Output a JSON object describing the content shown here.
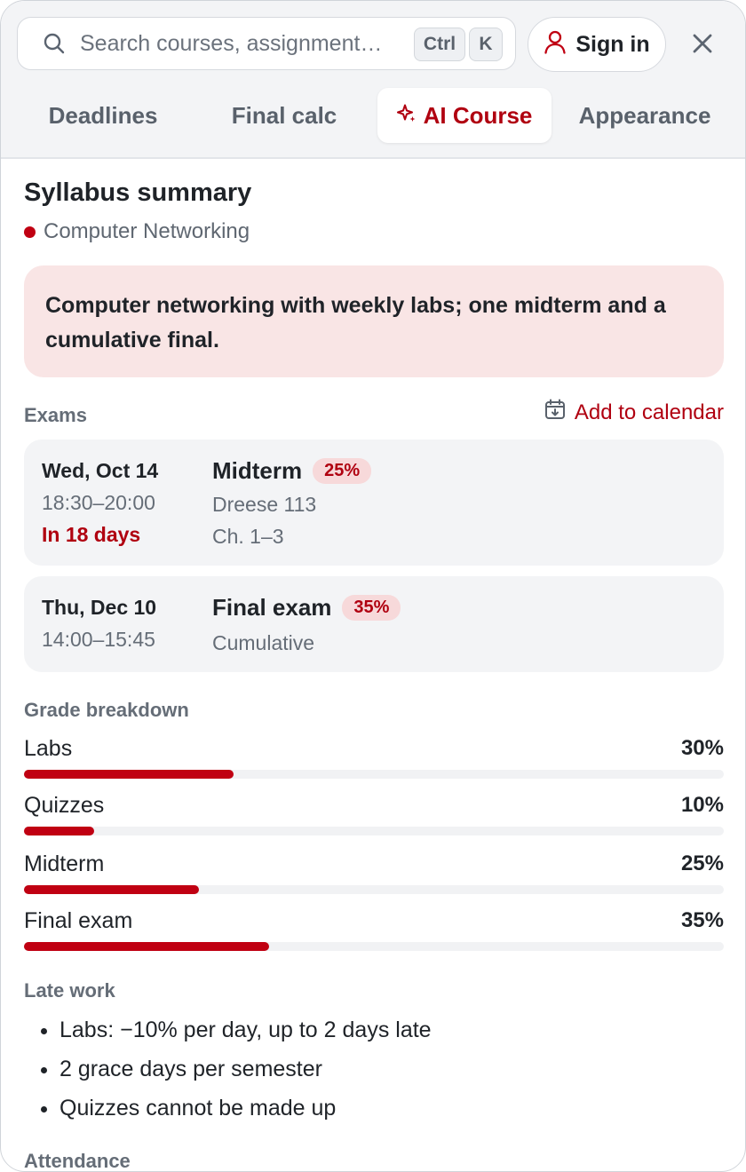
{
  "search": {
    "placeholder": "Search courses, assignment…",
    "shortcut_keys": [
      "Ctrl",
      "K"
    ]
  },
  "header": {
    "sign_in_label": "Sign in"
  },
  "tabs": [
    {
      "label": "Deadlines",
      "active": false
    },
    {
      "label": "Final calc",
      "active": false
    },
    {
      "label": "AI Course",
      "active": true,
      "icon": "sparkle-icon"
    },
    {
      "label": "Appearance",
      "active": false
    }
  ],
  "syllabus": {
    "title": "Syllabus summary",
    "course_name": "Computer Networking",
    "summary": "Computer networking with weekly labs; one midterm and a cumulative final."
  },
  "exams": {
    "label": "Exams",
    "add_to_calendar": "Add to calendar",
    "items": [
      {
        "date": "Wed, Oct 14",
        "time": "18:30–20:00",
        "relative": "In 18 days",
        "name": "Midterm",
        "weight": "25%",
        "details": [
          "Dreese 113",
          "Ch. 1–3"
        ]
      },
      {
        "date": "Thu, Dec 10",
        "time": "14:00–15:45",
        "relative": "",
        "name": "Final exam",
        "weight": "35%",
        "details": [
          "Cumulative"
        ]
      }
    ]
  },
  "grade_breakdown": {
    "label": "Grade breakdown",
    "items": [
      {
        "name": "Labs",
        "percent_label": "30%",
        "percent": 30
      },
      {
        "name": "Quizzes",
        "percent_label": "10%",
        "percent": 10
      },
      {
        "name": "Midterm",
        "percent_label": "25%",
        "percent": 25
      },
      {
        "name": "Final exam",
        "percent_label": "35%",
        "percent": 35
      }
    ]
  },
  "late_work": {
    "label": "Late work",
    "items": [
      "Labs: −10% per day, up to 2 days late",
      "2 grace days per semester",
      "Quizzes cannot be made up"
    ]
  },
  "attendance": {
    "label": "Attendance"
  },
  "colors": {
    "accent": "#c00012",
    "accent_text": "#b00010",
    "summary_bg": "#f9e5e5",
    "card_bg": "#f3f4f6"
  }
}
